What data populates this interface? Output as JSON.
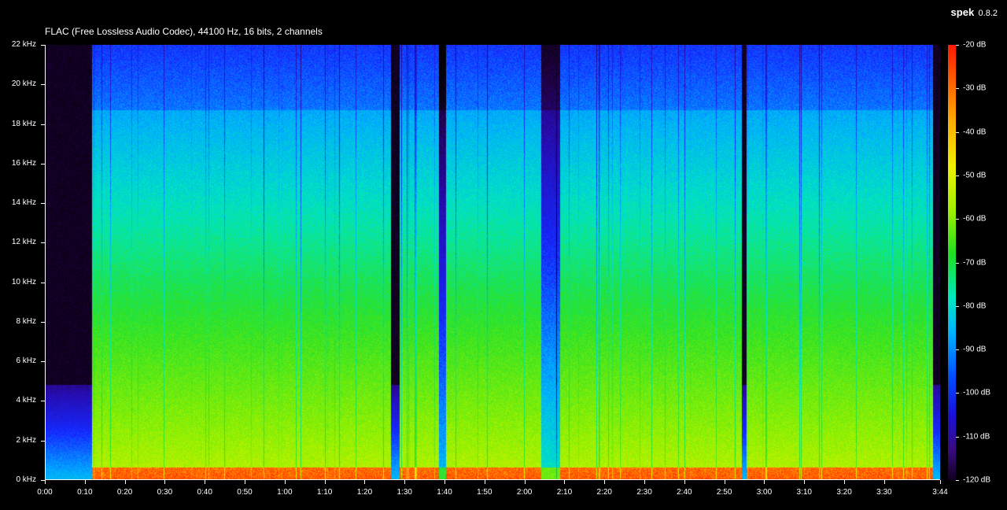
{
  "file_info": "FLAC (Free Lossless Audio Codec), 44100 Hz, 16 bits, 2 channels",
  "brand": {
    "app": "spek",
    "version": "0.8.2"
  },
  "y_axis": {
    "unit": "kHz",
    "labels": [
      "22 kHz",
      "20 kHz",
      "18 kHz",
      "16 kHz",
      "14 kHz",
      "12 kHz",
      "10 kHz",
      "8 kHz",
      "6 kHz",
      "4 kHz",
      "2 kHz",
      "0 kHz"
    ],
    "values": [
      22,
      20,
      18,
      16,
      14,
      12,
      10,
      8,
      6,
      4,
      2,
      0
    ]
  },
  "x_axis": {
    "labels": [
      "0:00",
      "0:10",
      "0:20",
      "0:30",
      "0:40",
      "0:50",
      "1:00",
      "1:10",
      "1:20",
      "1:30",
      "1:40",
      "1:50",
      "2:00",
      "2:10",
      "2:20",
      "2:30",
      "2:40",
      "2:50",
      "3:00",
      "3:10",
      "3:20",
      "3:30",
      "3:44"
    ],
    "seconds": [
      0,
      10,
      20,
      30,
      40,
      50,
      60,
      70,
      80,
      90,
      100,
      110,
      120,
      130,
      140,
      150,
      160,
      170,
      180,
      190,
      200,
      210,
      224
    ]
  },
  "color_scale": {
    "labels": [
      "-20 dB",
      "-30 dB",
      "-40 dB",
      "-50 dB",
      "-60 dB",
      "-70 dB",
      "-80 dB",
      "-90 dB",
      "-100 dB",
      "-110 dB",
      "-120 dB"
    ],
    "values": [
      -20,
      -30,
      -40,
      -50,
      -60,
      -70,
      -80,
      -90,
      -100,
      -110,
      -120
    ]
  },
  "duration_seconds": 224,
  "max_freq_khz": 22
}
